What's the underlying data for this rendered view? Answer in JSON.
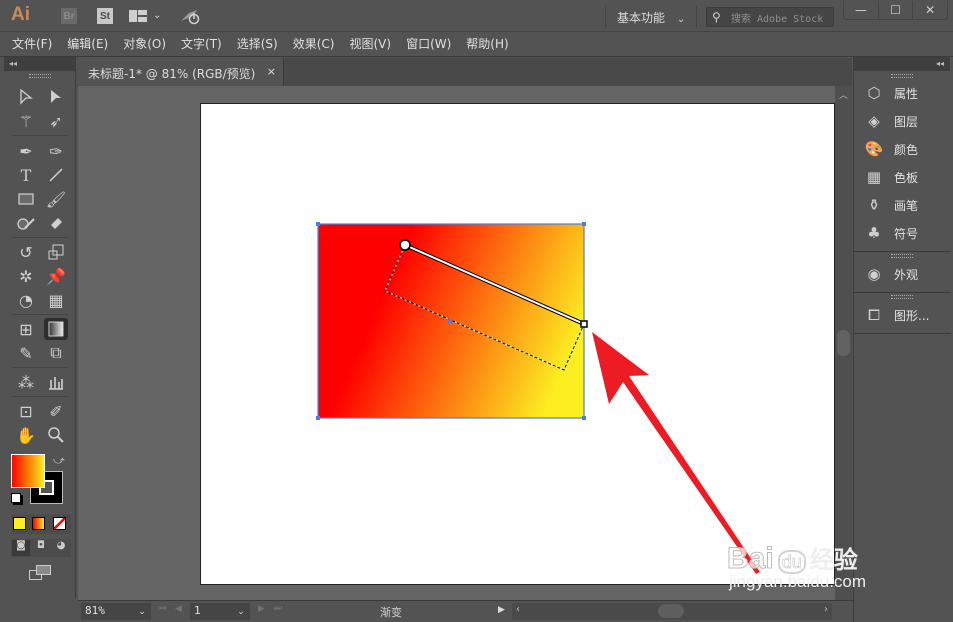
{
  "app": {
    "logo": "Ai",
    "bridge_label": "Br",
    "stock_label": "St",
    "workspace": "基本功能",
    "search_placeholder": "搜索 Adobe Stock"
  },
  "window_controls": {
    "minimize": "—",
    "maximize": "☐",
    "close": "✕"
  },
  "menu": [
    {
      "label": "文件(F)"
    },
    {
      "label": "编辑(E)"
    },
    {
      "label": "对象(O)"
    },
    {
      "label": "文字(T)"
    },
    {
      "label": "选择(S)"
    },
    {
      "label": "效果(C)"
    },
    {
      "label": "视图(V)"
    },
    {
      "label": "窗口(W)"
    },
    {
      "label": "帮助(H)"
    }
  ],
  "document_tab": {
    "title": "未标题-1* @ 81% (RGB/预览)",
    "close": "×"
  },
  "tools": [
    {
      "name": "selection-tool"
    },
    {
      "name": "direct-selection-tool"
    },
    {
      "name": "magic-wand-tool"
    },
    {
      "name": "lasso-tool"
    },
    {
      "name": "pen-tool"
    },
    {
      "name": "curvature-tool"
    },
    {
      "name": "type-tool",
      "glyph": "T"
    },
    {
      "name": "line-segment-tool"
    },
    {
      "name": "rectangle-tool"
    },
    {
      "name": "paintbrush-tool"
    },
    {
      "name": "shaper-tool"
    },
    {
      "name": "eraser-tool"
    },
    {
      "name": "rotate-tool"
    },
    {
      "name": "scale-tool"
    },
    {
      "name": "puppet-warp-tool"
    },
    {
      "name": "pin-tool"
    },
    {
      "name": "shape-builder-tool"
    },
    {
      "name": "perspective-grid-tool"
    },
    {
      "name": "mesh-tool"
    },
    {
      "name": "gradient-tool",
      "selected": true
    },
    {
      "name": "eyedropper-tool"
    },
    {
      "name": "blend-tool"
    },
    {
      "name": "symbol-sprayer-tool"
    },
    {
      "name": "column-graph-tool"
    },
    {
      "name": "artboard-tool"
    },
    {
      "name": "slice-tool"
    },
    {
      "name": "hand-tool"
    },
    {
      "name": "zoom-tool"
    }
  ],
  "colors": {
    "gradient_start": "#ff0000",
    "gradient_end": "#fcee21",
    "stroke": "#000000",
    "annotation_arrow": "#ed1c24",
    "selection_blue": "#4a7fe0"
  },
  "right_panel": {
    "items": [
      {
        "label": "属性",
        "icon": "properties-icon"
      },
      {
        "label": "图层",
        "icon": "layers-icon"
      },
      {
        "label": "颜色",
        "icon": "color-palette-icon"
      },
      {
        "label": "色板",
        "icon": "swatches-icon"
      },
      {
        "label": "画笔",
        "icon": "brushes-icon"
      },
      {
        "label": "符号",
        "icon": "symbols-club-icon"
      },
      {
        "label": "外观",
        "icon": "appearance-icon"
      },
      {
        "label": "图形...",
        "icon": "graphic-styles-icon"
      }
    ]
  },
  "status": {
    "zoom": "81%",
    "artboard_number": "1",
    "current_tool": "渐变"
  },
  "watermark": {
    "brand": "Bai",
    "brand2": "du",
    "cn": "经验",
    "url": "jingyan.baidu.com"
  }
}
